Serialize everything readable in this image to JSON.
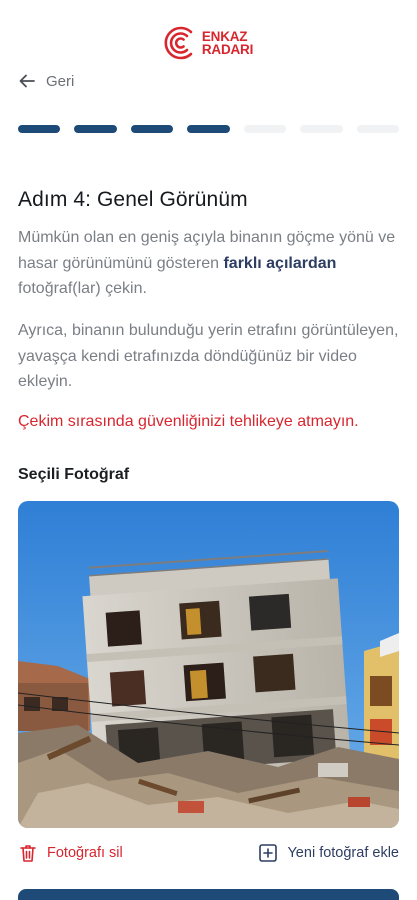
{
  "brand": {
    "line1": "ENKAZ",
    "line2": "RADARI",
    "color": "#d8262f"
  },
  "nav": {
    "back_label": "Geri"
  },
  "progress": {
    "total_steps": 7,
    "completed_steps": 4,
    "active_color": "#1e4a78",
    "inactive_color": "#f1f2f4"
  },
  "step": {
    "title": "Adım 4: Genel Görünüm",
    "p1_part1": "Mümkün olan en geniş açıyla binanın göçme yönü ve hasar görünümünü gösteren ",
    "p1_bold": "farklı açılardan",
    "p1_part2": " fotoğraf(lar) çekin.",
    "p2": "Ayrıca, binanın bulunduğu yerin etrafını görüntüleyen, yavaşça kendi etrafınızda döndüğünüz bir video ekleyin.",
    "warning": "Çekim sırasında güvenliğinizi tehlikeye atmayın."
  },
  "selected": {
    "label": "Seçili Fotoğraf",
    "delete_label": "Fotoğrafı sil",
    "add_label": "Yeni fotoğraf ekle"
  },
  "colors": {
    "danger": "#d8262f",
    "primary": "#2e3e62",
    "cta": "#1e4a78"
  }
}
